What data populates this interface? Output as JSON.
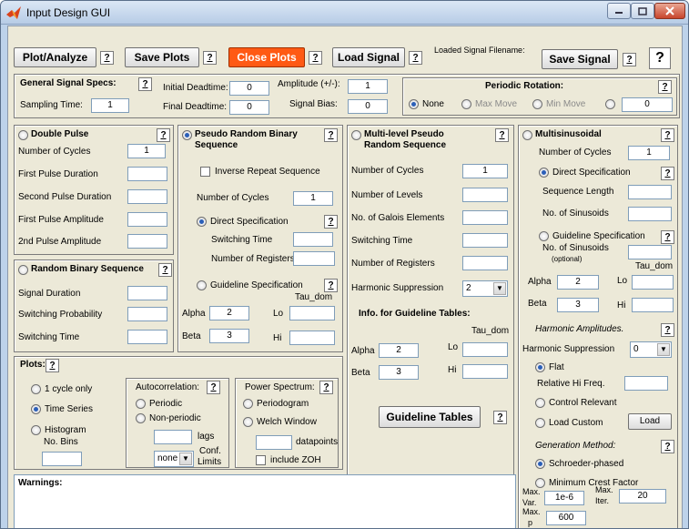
{
  "window": {
    "title": "Input Design GUI",
    "icon": "matlab-logo-icon",
    "minimize_icon": "minimize-icon",
    "maximize_icon": "maximize-icon",
    "close_icon": "close-icon"
  },
  "colors": {
    "close_plots_button": "#ff5a14",
    "window_frame": "#bdd2ea",
    "panel_bg": "#ece9d8"
  },
  "toolbar": {
    "plot_analyze": "Plot/Analyze",
    "save_plots": "Save Plots",
    "close_plots": "Close Plots",
    "load_signal": "Load Signal",
    "loaded_filename_label": "Loaded Signal Filename:",
    "save_signal": "Save Signal",
    "help": "?",
    "big_help": "?"
  },
  "general": {
    "title": "General Signal Specs:",
    "sampling_time_label": "Sampling Time:",
    "sampling_time": "1",
    "initial_deadtime_label": "Initial Deadtime:",
    "initial_deadtime": "0",
    "final_deadtime_label": "Final Deadtime:",
    "final_deadtime": "0",
    "amplitude_label": "Amplitude (+/-):",
    "amplitude": "1",
    "signal_bias_label": "Signal Bias:",
    "signal_bias": "0"
  },
  "periodic": {
    "title": "Periodic Rotation:",
    "none": "None",
    "max_move": "Max Move",
    "min_move": "Min Move",
    "value": "0"
  },
  "double_pulse": {
    "title": "Double Pulse",
    "cycles_label": "Number of Cycles",
    "cycles": "1",
    "first_duration": "First Pulse Duration",
    "second_duration": "Second Pulse Duration",
    "first_amplitude": "First Pulse Amplitude",
    "second_amplitude": "2nd Pulse Amplitude"
  },
  "random_binary": {
    "title": "Random Binary Sequence",
    "signal_duration": "Signal Duration",
    "switching_probability": "Switching Probability",
    "switching_time": "Switching Time"
  },
  "prbs": {
    "title_line1": "Pseudo Random Binary",
    "title_line2": "Sequence",
    "inverse_repeat": "Inverse Repeat Sequence",
    "cycles_label": "Number of Cycles",
    "cycles": "1",
    "direct": "Direct Specification",
    "switching_time": "Switching Time",
    "registers": "Number of Registers",
    "guideline": "Guideline Specification",
    "tau_dom": "Tau_dom",
    "alpha_label": "Alpha",
    "alpha": "2",
    "beta_label": "Beta",
    "beta": "3",
    "lo": "Lo",
    "hi": "Hi"
  },
  "multilevel": {
    "title_line1": "Multi-level Pseudo",
    "title_line2": "Random Sequence",
    "cycles_label": "Number of Cycles",
    "cycles": "1",
    "levels": "Number of Levels",
    "galois": "No. of Galois Elements",
    "switching_time": "Switching Time",
    "registers": "Number of Registers",
    "harmonic_label": "Harmonic Suppression",
    "harmonic_value": "2",
    "info_title": "Info. for Guideline Tables:",
    "tau_dom": "Tau_dom",
    "alpha_label": "Alpha",
    "alpha": "2",
    "beta_label": "Beta",
    "beta": "3",
    "lo": "Lo",
    "hi": "Hi",
    "guideline_tables": "Guideline Tables"
  },
  "multisine": {
    "title": "Multisinusoidal",
    "cycles_label": "Number of Cycles",
    "cycles": "1",
    "direct": "Direct Specification",
    "sequence_length": "Sequence Length",
    "no_sinusoids": "No. of Sinusoids",
    "guideline": "Guideline Specification",
    "no_sinusoids2": "No. of Sinusoids",
    "optional": "(optional)",
    "tau_dom": "Tau_dom",
    "alpha_label": "Alpha",
    "alpha": "2",
    "beta_label": "Beta",
    "beta": "3",
    "lo": "Lo",
    "hi": "Hi",
    "harmonic_amplitudes": "Harmonic Amplitudes.",
    "harmonic_label": "Harmonic Suppression",
    "harmonic_value": "0",
    "flat": "Flat",
    "relative_hi": "Relative Hi Freq.",
    "control_relevant": "Control Relevant",
    "load_custom": "Load Custom",
    "load_button": "Load",
    "generation_method": "Generation Method:",
    "schroeder": "Schroeder-phased",
    "min_crest": "Minimum Crest Factor",
    "max_var_l1": "Max.",
    "max_var_l2": "Var.",
    "max_var": "1e-6",
    "max_iter_l1": "Max.",
    "max_iter_l2": "Iter.",
    "max_iter": "20",
    "max_p_l1": "Max.",
    "max_p_l2": "p",
    "max_p": "600"
  },
  "plots": {
    "title": "Plots:",
    "one_cycle": "1 cycle only",
    "time_series": "Time Series",
    "histogram": "Histogram",
    "no_bins": "No. Bins",
    "autocorrelation": "Autocorrelation:",
    "periodic": "Periodic",
    "non_periodic": "Non-periodic",
    "lags": "lags",
    "conf_value": "none",
    "conf_l1": "Conf.",
    "conf_l2": "Limits",
    "power_spectrum": "Power Spectrum:",
    "periodogram": "Periodogram",
    "welch": "Welch Window",
    "datapoints": "datapoints",
    "include_zoh": "include ZOH"
  },
  "warnings": {
    "title": "Warnings:"
  }
}
